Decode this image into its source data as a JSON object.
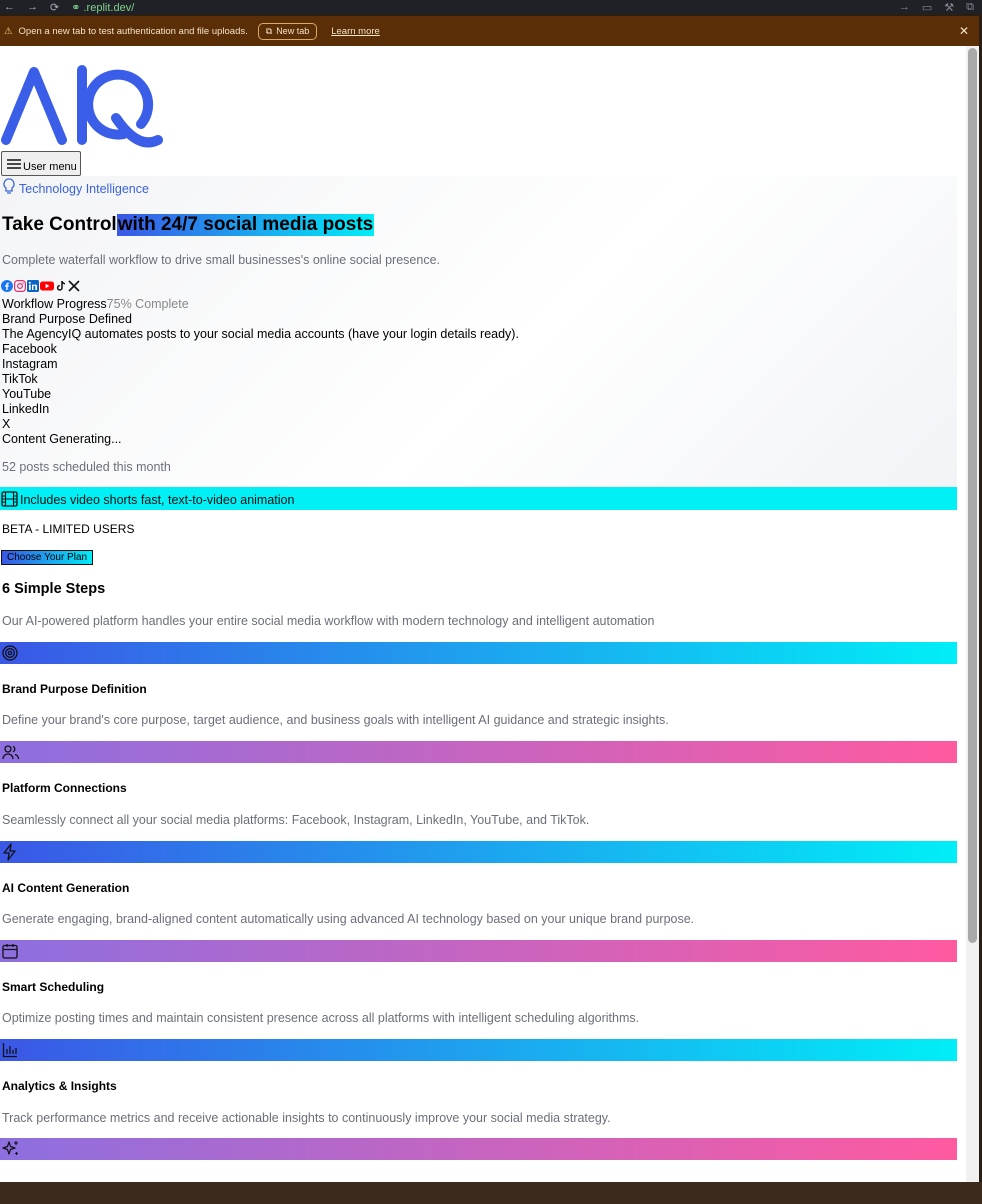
{
  "browser": {
    "url": ".replit.dev/"
  },
  "banner": {
    "message": "Open a new tab to test authentication and file uploads.",
    "new_tab_label": "New tab",
    "learn_more_label": "Learn more"
  },
  "brand": {
    "logo_text": "AIQ",
    "colors": {
      "logo": "#3a5ee8",
      "accent_start": "#3b57e6",
      "accent_end": "#00ecf6",
      "pink_start": "#8d6fe0",
      "pink_end": "#ff5aa0"
    }
  },
  "menu": {
    "label": "User menu"
  },
  "hero": {
    "tag": "Technology Intelligence",
    "title_plain": "Take Control",
    "title_highlight": "with 24/7 social media posts",
    "subtitle": "Complete waterfall workflow to drive small businesses's online social presence.",
    "social_icons": [
      "facebook-icon",
      "instagram-icon",
      "linkedin-icon",
      "youtube-icon",
      "tiktok-icon",
      "x-icon"
    ],
    "progress_label": "Workflow Progress",
    "progress_status": "75% Complete",
    "progress_value": 0.75,
    "brand_purpose": "Brand Purpose Defined",
    "automation_note": "The AgencyIQ automates posts to your social media accounts (have your login details ready).",
    "platforms": [
      "Facebook",
      "Instagram",
      "TikTok",
      "YouTube",
      "LinkedIn",
      "X"
    ],
    "generating": "Content Generating...",
    "posts_scheduled": "52 posts scheduled this month"
  },
  "video_banner": {
    "text": "Includes video shorts fast, text-to-video animation"
  },
  "beta": {
    "text": "BETA - LIMITED USERS",
    "cta": "Choose Your Plan"
  },
  "steps": {
    "title": "6 Simple Steps",
    "subtitle": "Our AI-powered platform handles your entire social media workflow with modern technology and intelligent automation",
    "items": [
      {
        "icon": "target-icon",
        "title": "Brand Purpose Definition",
        "desc": "Define your brand's core purpose, target audience, and business goals with intelligent AI guidance and strategic insights."
      },
      {
        "icon": "users-icon",
        "title": "Platform Connections",
        "desc": "Seamlessly connect all your social media platforms: Facebook, Instagram, LinkedIn, YouTube, and TikTok."
      },
      {
        "icon": "lightning-icon",
        "title": "AI Content Generation",
        "desc": "Generate engaging, brand-aligned content automatically using advanced AI technology based on your unique brand purpose."
      },
      {
        "icon": "calendar-icon",
        "title": "Smart Scheduling",
        "desc": "Optimize posting times and maintain consistent presence across all platforms with intelligent scheduling algorithms."
      },
      {
        "icon": "bar-chart-icon",
        "title": "Analytics & Insights",
        "desc": "Track performance metrics and receive actionable insights to continuously improve your social media strategy."
      },
      {
        "icon": "sparkles-icon",
        "title": "",
        "desc": ""
      }
    ]
  }
}
